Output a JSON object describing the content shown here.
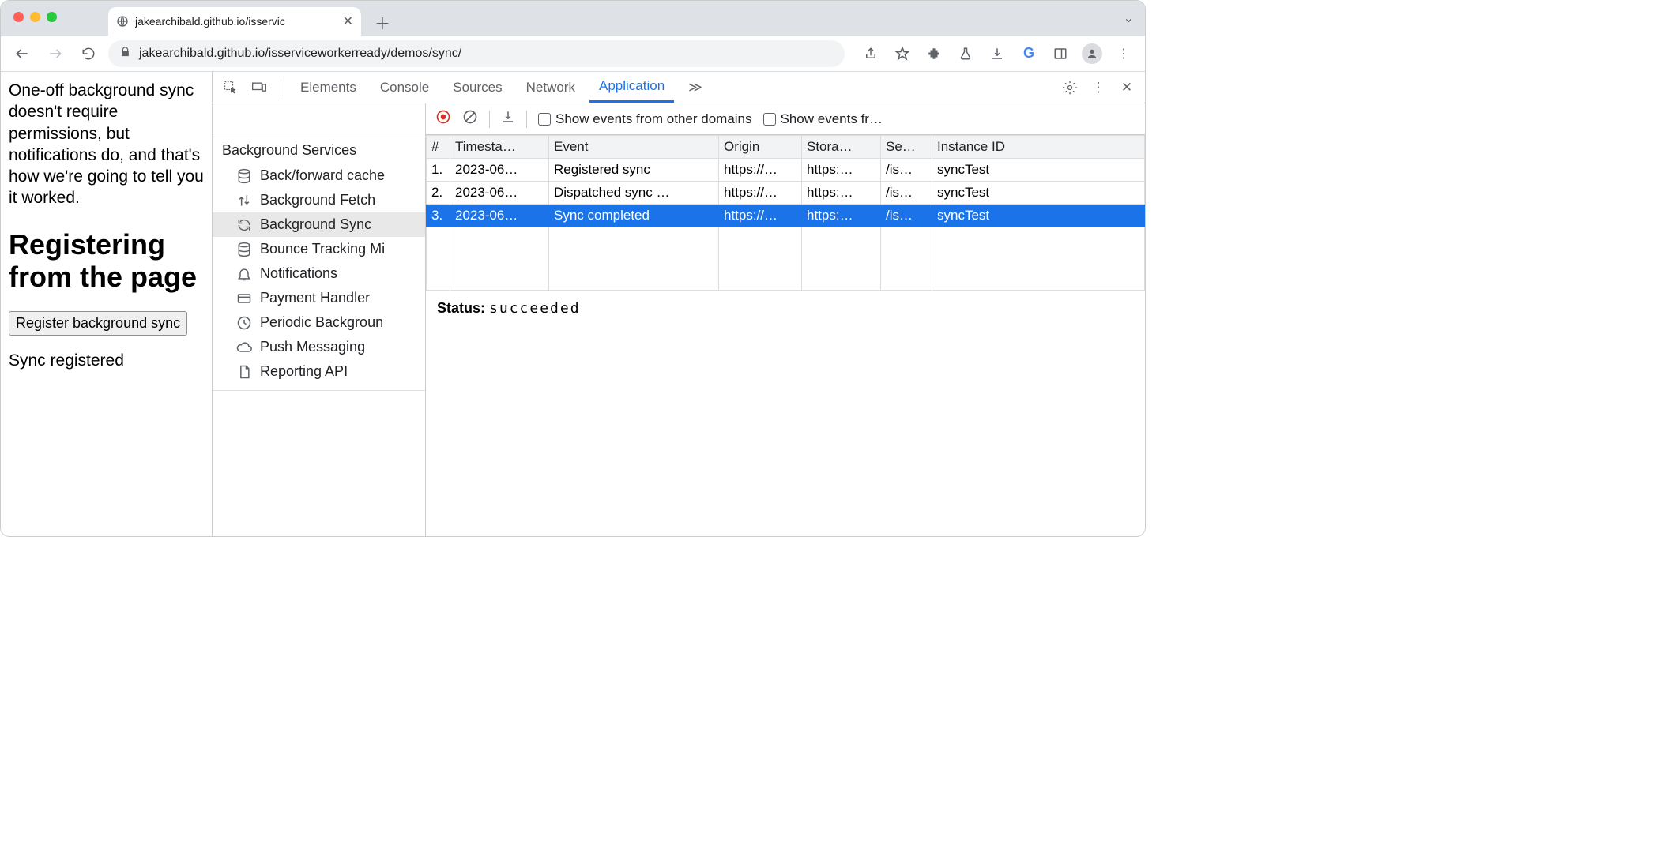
{
  "browser": {
    "tab_title": "jakearchibald.github.io/isservic",
    "url_display": "jakearchibald.github.io/isserviceworkerready/demos/sync/"
  },
  "page": {
    "intro": "One-off background sync doesn't require permissions, but notifications do, and that's how we're going to tell you it worked.",
    "heading": "Registering from the page",
    "button_label": "Register background sync",
    "status_text": "Sync registered"
  },
  "devtools": {
    "tabs": [
      "Elements",
      "Console",
      "Sources",
      "Network",
      "Application"
    ],
    "tabs_more": "≫",
    "active_tab": "Application",
    "sidebar": {
      "group_title": "Background Services",
      "items": [
        {
          "icon": "db",
          "label": "Back/forward cache"
        },
        {
          "icon": "updown",
          "label": "Background Fetch"
        },
        {
          "icon": "sync",
          "label": "Background Sync"
        },
        {
          "icon": "db",
          "label": "Bounce Tracking Mi"
        },
        {
          "icon": "bell",
          "label": "Notifications"
        },
        {
          "icon": "card",
          "label": "Payment Handler"
        },
        {
          "icon": "clock",
          "label": "Periodic Backgroun"
        },
        {
          "icon": "cloud",
          "label": "Push Messaging"
        },
        {
          "icon": "file",
          "label": "Reporting API"
        }
      ],
      "selected_index": 2
    },
    "events_toolbar": {
      "show_other_label": "Show events from other domains",
      "show_fr_label": "Show events fr…"
    },
    "events_table": {
      "columns": [
        "#",
        "Timesta…",
        "Event",
        "Origin",
        "Stora…",
        "Se…",
        "Instance ID"
      ],
      "rows": [
        {
          "n": "1.",
          "ts": "2023-06…",
          "event": "Registered sync",
          "origin": "https://…",
          "storage": "https:…",
          "scope": "/is…",
          "instance": "syncTest"
        },
        {
          "n": "2.",
          "ts": "2023-06…",
          "event": "Dispatched sync …",
          "origin": "https://…",
          "storage": "https:…",
          "scope": "/is…",
          "instance": "syncTest"
        },
        {
          "n": "3.",
          "ts": "2023-06…",
          "event": "Sync completed",
          "origin": "https://…",
          "storage": "https:…",
          "scope": "/is…",
          "instance": "syncTest"
        }
      ],
      "selected_row": 2
    },
    "status": {
      "label": "Status:",
      "value": "succeeded"
    }
  }
}
